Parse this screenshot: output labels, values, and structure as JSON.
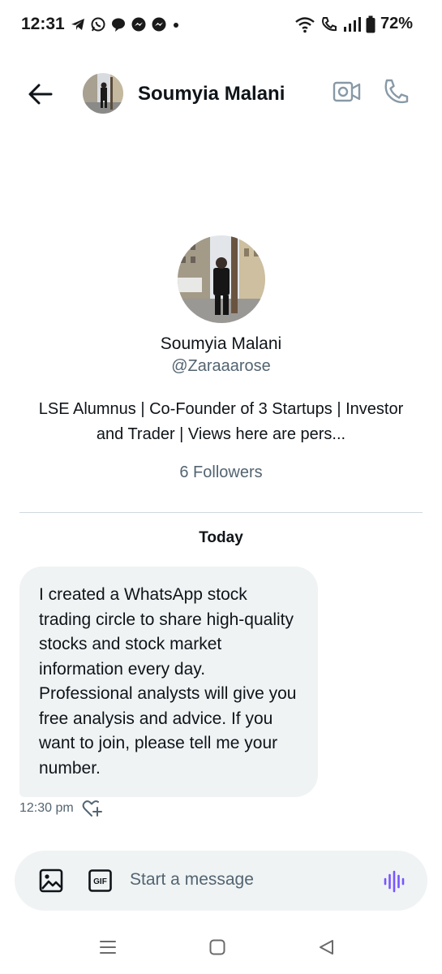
{
  "status_bar": {
    "time": "12:31",
    "left_icons": [
      "telegram-icon",
      "whatsapp-icon",
      "chat-icon",
      "messenger-icon",
      "messenger-icon",
      "dot-icon"
    ],
    "right_icons": [
      "wifi-icon",
      "wifi-calling-icon",
      "signal-icon",
      "battery-icon"
    ],
    "battery": "72%"
  },
  "header": {
    "contact_name": "Soumyia Malani",
    "actions": [
      "video-call-icon",
      "phone-call-icon"
    ]
  },
  "profile": {
    "name": "Soumyia Malani",
    "handle": "@Zaraaarose",
    "bio": "LSE Alumnus | Co-Founder of 3 Startups | Investor and Trader | Views here are pers...",
    "followers": "6 Followers"
  },
  "conversation": {
    "date_label": "Today",
    "messages": [
      {
        "text": "I created a WhatsApp stock trading circle to share high-quality stocks and stock market information every day. Professional analysts will give you free analysis and advice. If you want to join, please tell me your number.",
        "time": "12:30 pm"
      }
    ]
  },
  "composer": {
    "placeholder": "Start a message",
    "gif_label": "GIF"
  },
  "colors": {
    "text_primary": "#0f1419",
    "text_secondary": "#536471",
    "bubble_bg": "#eff3f4",
    "voice_accent": "#7856ff"
  }
}
